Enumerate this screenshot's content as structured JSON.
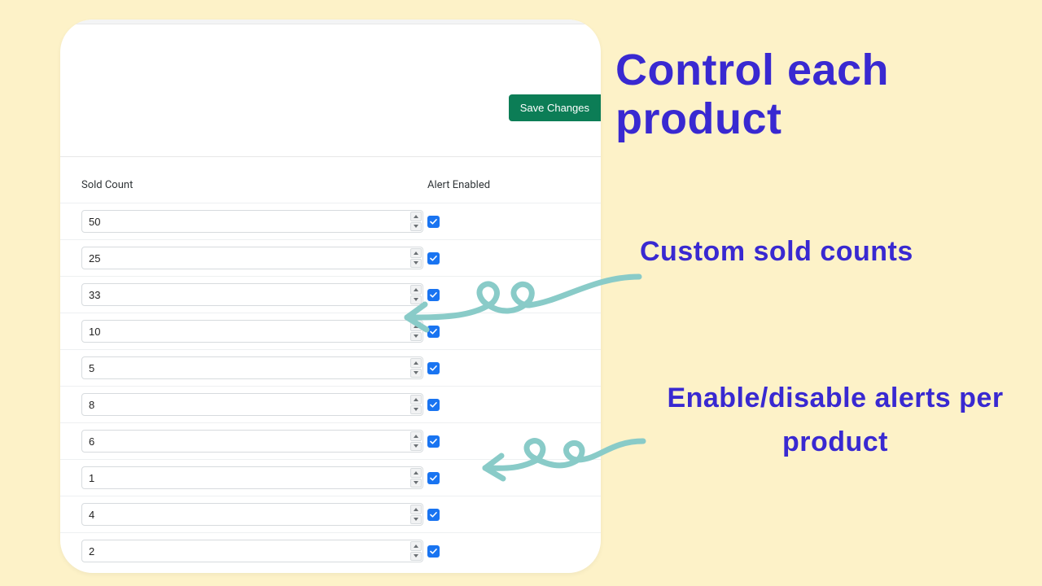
{
  "buttons": {
    "save": "Save Changes"
  },
  "headers": {
    "sold": "Sold Count",
    "alert": "Alert Enabled"
  },
  "rows": [
    {
      "sold": "50",
      "alert": true
    },
    {
      "sold": "25",
      "alert": true
    },
    {
      "sold": "33",
      "alert": true
    },
    {
      "sold": "10",
      "alert": true
    },
    {
      "sold": "5",
      "alert": true
    },
    {
      "sold": "8",
      "alert": true
    },
    {
      "sold": "6",
      "alert": true
    },
    {
      "sold": "1",
      "alert": true
    },
    {
      "sold": "4",
      "alert": true
    },
    {
      "sold": "2",
      "alert": true
    }
  ],
  "annotations": {
    "title": "Control each product",
    "sub1": "Custom sold counts",
    "sub2": "Enable/disable alerts per product"
  },
  "colors": {
    "accent": "#3929d1",
    "save_bg": "#0c7d56",
    "checkbox": "#1974f1",
    "arrow": "#89cbc8",
    "page_bg": "#fdf2c8"
  }
}
